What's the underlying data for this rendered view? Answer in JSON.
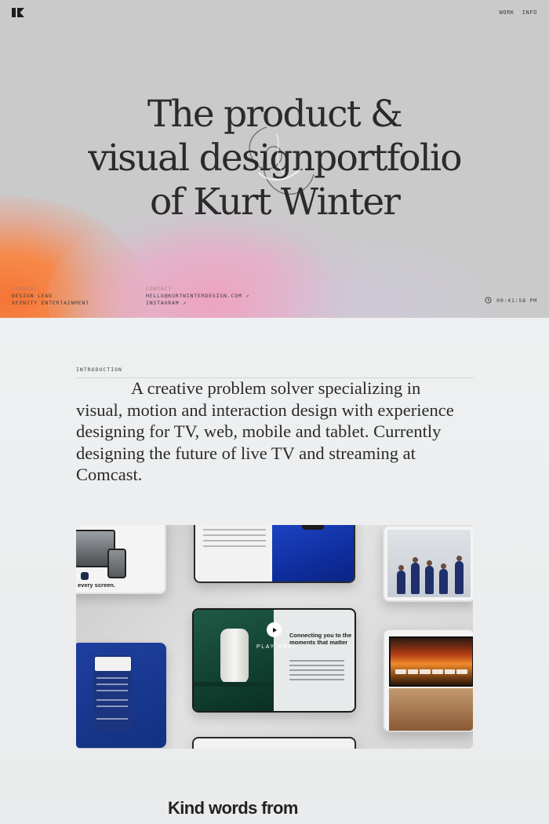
{
  "nav": {
    "logo_label": "KW",
    "links": [
      "WORK",
      "INFO"
    ]
  },
  "hero": {
    "title_lines": [
      "The product &",
      "visual designportfolio",
      "of Kurt Winter"
    ],
    "current": {
      "label": "CURRENT",
      "role": "DESIGN LEAD",
      "company": "XFINITY ENTERTAINMENT"
    },
    "contact": {
      "label": "CONTACT",
      "email": "HELLO@KURTWINTERDESIGN.COM ↗",
      "instagram": "INSTAGRAM ↗"
    },
    "clock": "00:41:58 PM"
  },
  "intro": {
    "label": "INTRODUCTION",
    "text": "A creative problem solver specializing in visual, motion and interaction design with experience designing for TV, web, mobile and tablet. Currently designing the future of live TV and streaming at Comcast."
  },
  "showcase": {
    "caption_left": "every screen.",
    "play_label": "PLAY REEL",
    "headline": "Connecting you to the moments that matter"
  },
  "testimonials": {
    "heading": "Kind words from"
  },
  "colors": {
    "hero_bg": "#cacacb",
    "accent_orange": "#f57535",
    "accent_pink": "#eea3c0",
    "page_bg": "#e9ebec"
  }
}
